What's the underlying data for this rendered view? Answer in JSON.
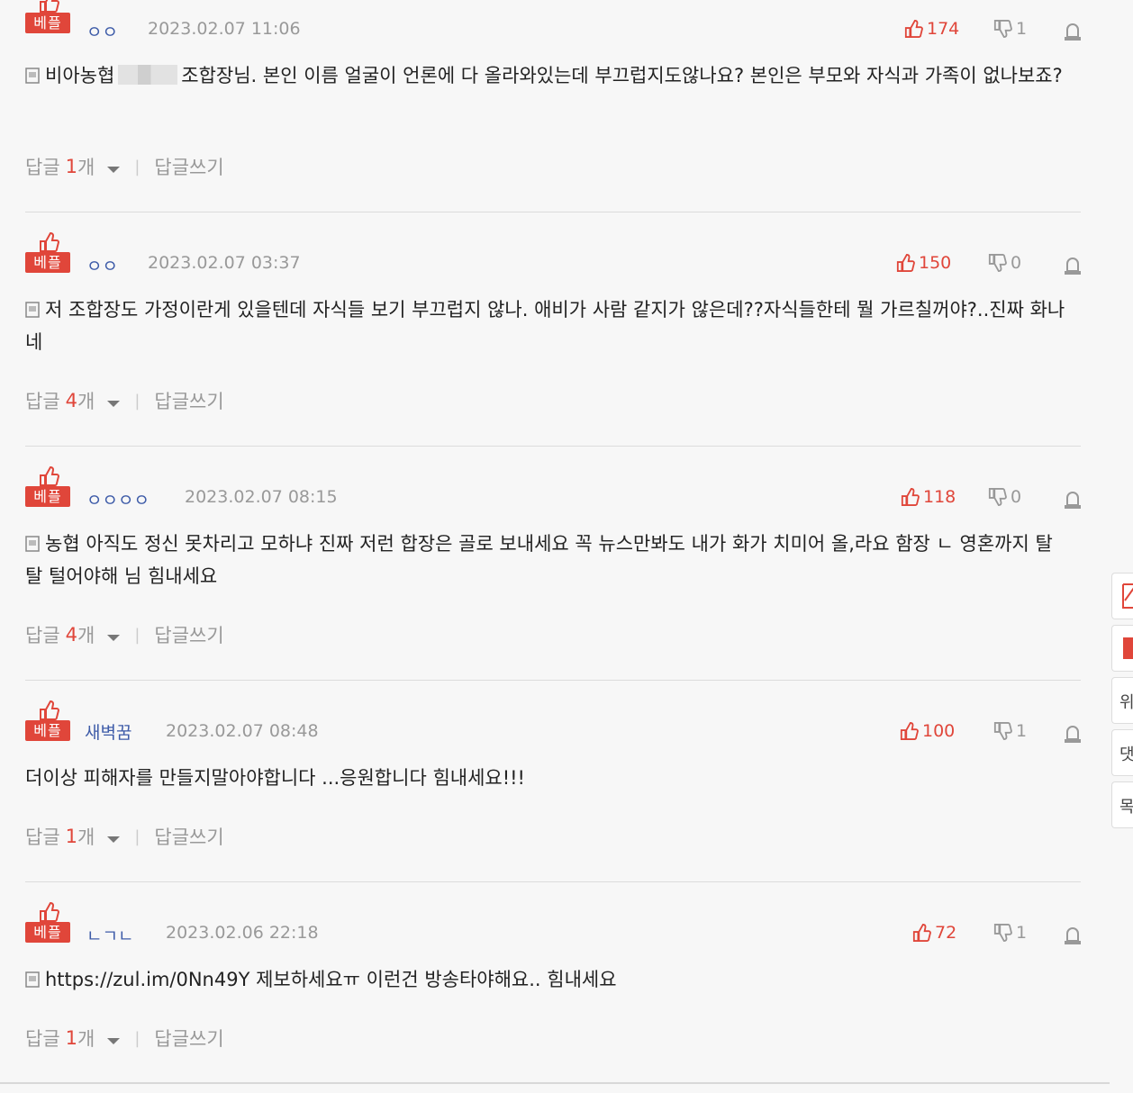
{
  "badge_label": "베플",
  "comments": [
    {
      "nickname": "ㅇㅇ",
      "date": "2023.02.07 11:06",
      "up": "174",
      "down": "1",
      "text_before": "비아농협",
      "text_after": "조합장님. 본인 이름 얼굴이 언론에 다 올라와있는데 부끄럽지도않나요? 본인은 부모와 자식과 가족이 없나보죠?",
      "reply_prefix": "답글",
      "reply_count": "1",
      "reply_suffix": "개",
      "write_reply": "답글쓰기"
    },
    {
      "nickname": "ㅇㅇ",
      "date": "2023.02.07 03:37",
      "up": "150",
      "down": "0",
      "text": "저 조합장도 가정이란게 있을텐데 자식들 보기 부끄럽지 않나. 애비가 사람 같지가 않은데??자식들한테 뭘 가르칠꺼야?..진짜 화나네",
      "reply_prefix": "답글",
      "reply_count": "4",
      "reply_suffix": "개",
      "write_reply": "답글쓰기"
    },
    {
      "nickname": "ㅇㅇㅇㅇ",
      "date": "2023.02.07 08:15",
      "up": "118",
      "down": "0",
      "text": "농협 아직도 정신 못차리고 모하냐 진짜 저런 합장은 골로 보내세요 꼭 뉴스만봐도 내가 화가 치미어 올,라요 함장 ㄴ 영혼까지 탈탈 털어야해 님 힘내세요",
      "reply_prefix": "답글",
      "reply_count": "4",
      "reply_suffix": "개",
      "write_reply": "답글쓰기"
    },
    {
      "nickname": "새벽꿈",
      "date": "2023.02.07 08:48",
      "up": "100",
      "down": "1",
      "text": "더이상 피해자를 만들지말아야합니다 ...응원합니다 힘내세요!!!",
      "reply_prefix": "답글",
      "reply_count": "1",
      "reply_suffix": "개",
      "write_reply": "답글쓰기"
    },
    {
      "nickname": "ㄴㄱㄴ",
      "date": "2023.02.06 22:18",
      "up": "72",
      "down": "1",
      "text": "https://zul.im/0Nn49Y 제보하세요ㅠ 이런건 방송타야해요.. 힘내세요",
      "reply_prefix": "답글",
      "reply_count": "1",
      "reply_suffix": "개",
      "write_reply": "답글쓰기"
    }
  ],
  "side_tabs": [
    "",
    "",
    "위",
    "댓",
    "목"
  ],
  "icons": {
    "best": "thumbs-up-icon",
    "up": "thumbs-up-icon",
    "down": "thumbs-down-icon",
    "report": "report-icon",
    "doc": "document-icon"
  },
  "colors": {
    "accent": "#e0463a",
    "nickname": "#3d5ba8",
    "muted": "#999999"
  }
}
